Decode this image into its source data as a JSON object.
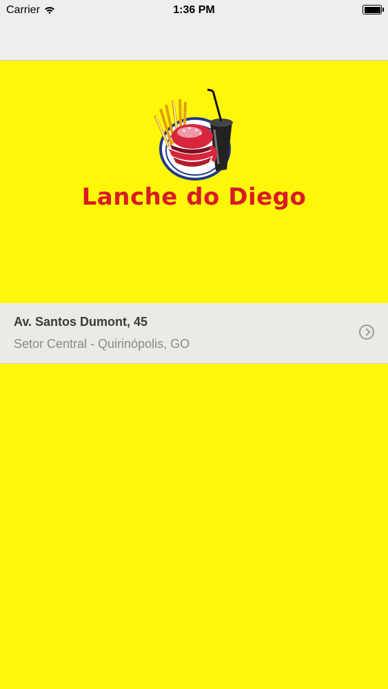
{
  "status_bar": {
    "carrier": "Carrier",
    "time": "1:36 PM"
  },
  "brand": {
    "name": "Lanche do Diego",
    "logo_icon": "burger-fries-drink-icon",
    "logo_color": "#d81b24"
  },
  "address": {
    "street": "Av. Santos Dumont, 45",
    "locality": "Setor Central - Quirinópolis, GO"
  },
  "colors": {
    "background": "#fff70a",
    "bar": "#efeeec"
  }
}
